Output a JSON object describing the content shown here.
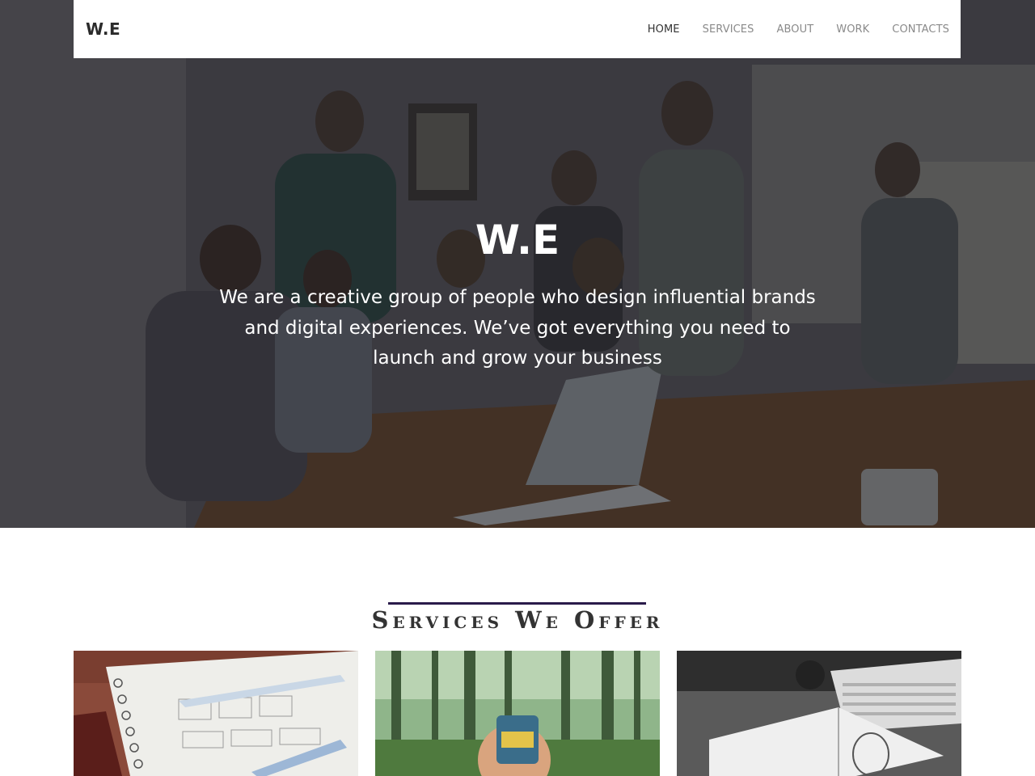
{
  "navbar": {
    "brand": "W.E",
    "items": [
      {
        "label": "HOME",
        "active": true
      },
      {
        "label": "SERVICES",
        "active": false
      },
      {
        "label": "ABOUT",
        "active": false
      },
      {
        "label": "WORK",
        "active": false
      },
      {
        "label": "CONTACTS",
        "active": false
      }
    ]
  },
  "hero": {
    "title": "W.E",
    "subtitle": "We are a creative group of people who design influential brands and digital experiences. We’ve got everything you need to launch and grow your business"
  },
  "services": {
    "title": "Services We Offer",
    "accent_color": "#2a1b4a",
    "cards": [
      {
        "image": "notebook-wireframe-photo"
      },
      {
        "image": "forest-hand-photo"
      },
      {
        "image": "sketchbook-keyboard-photo"
      }
    ]
  }
}
